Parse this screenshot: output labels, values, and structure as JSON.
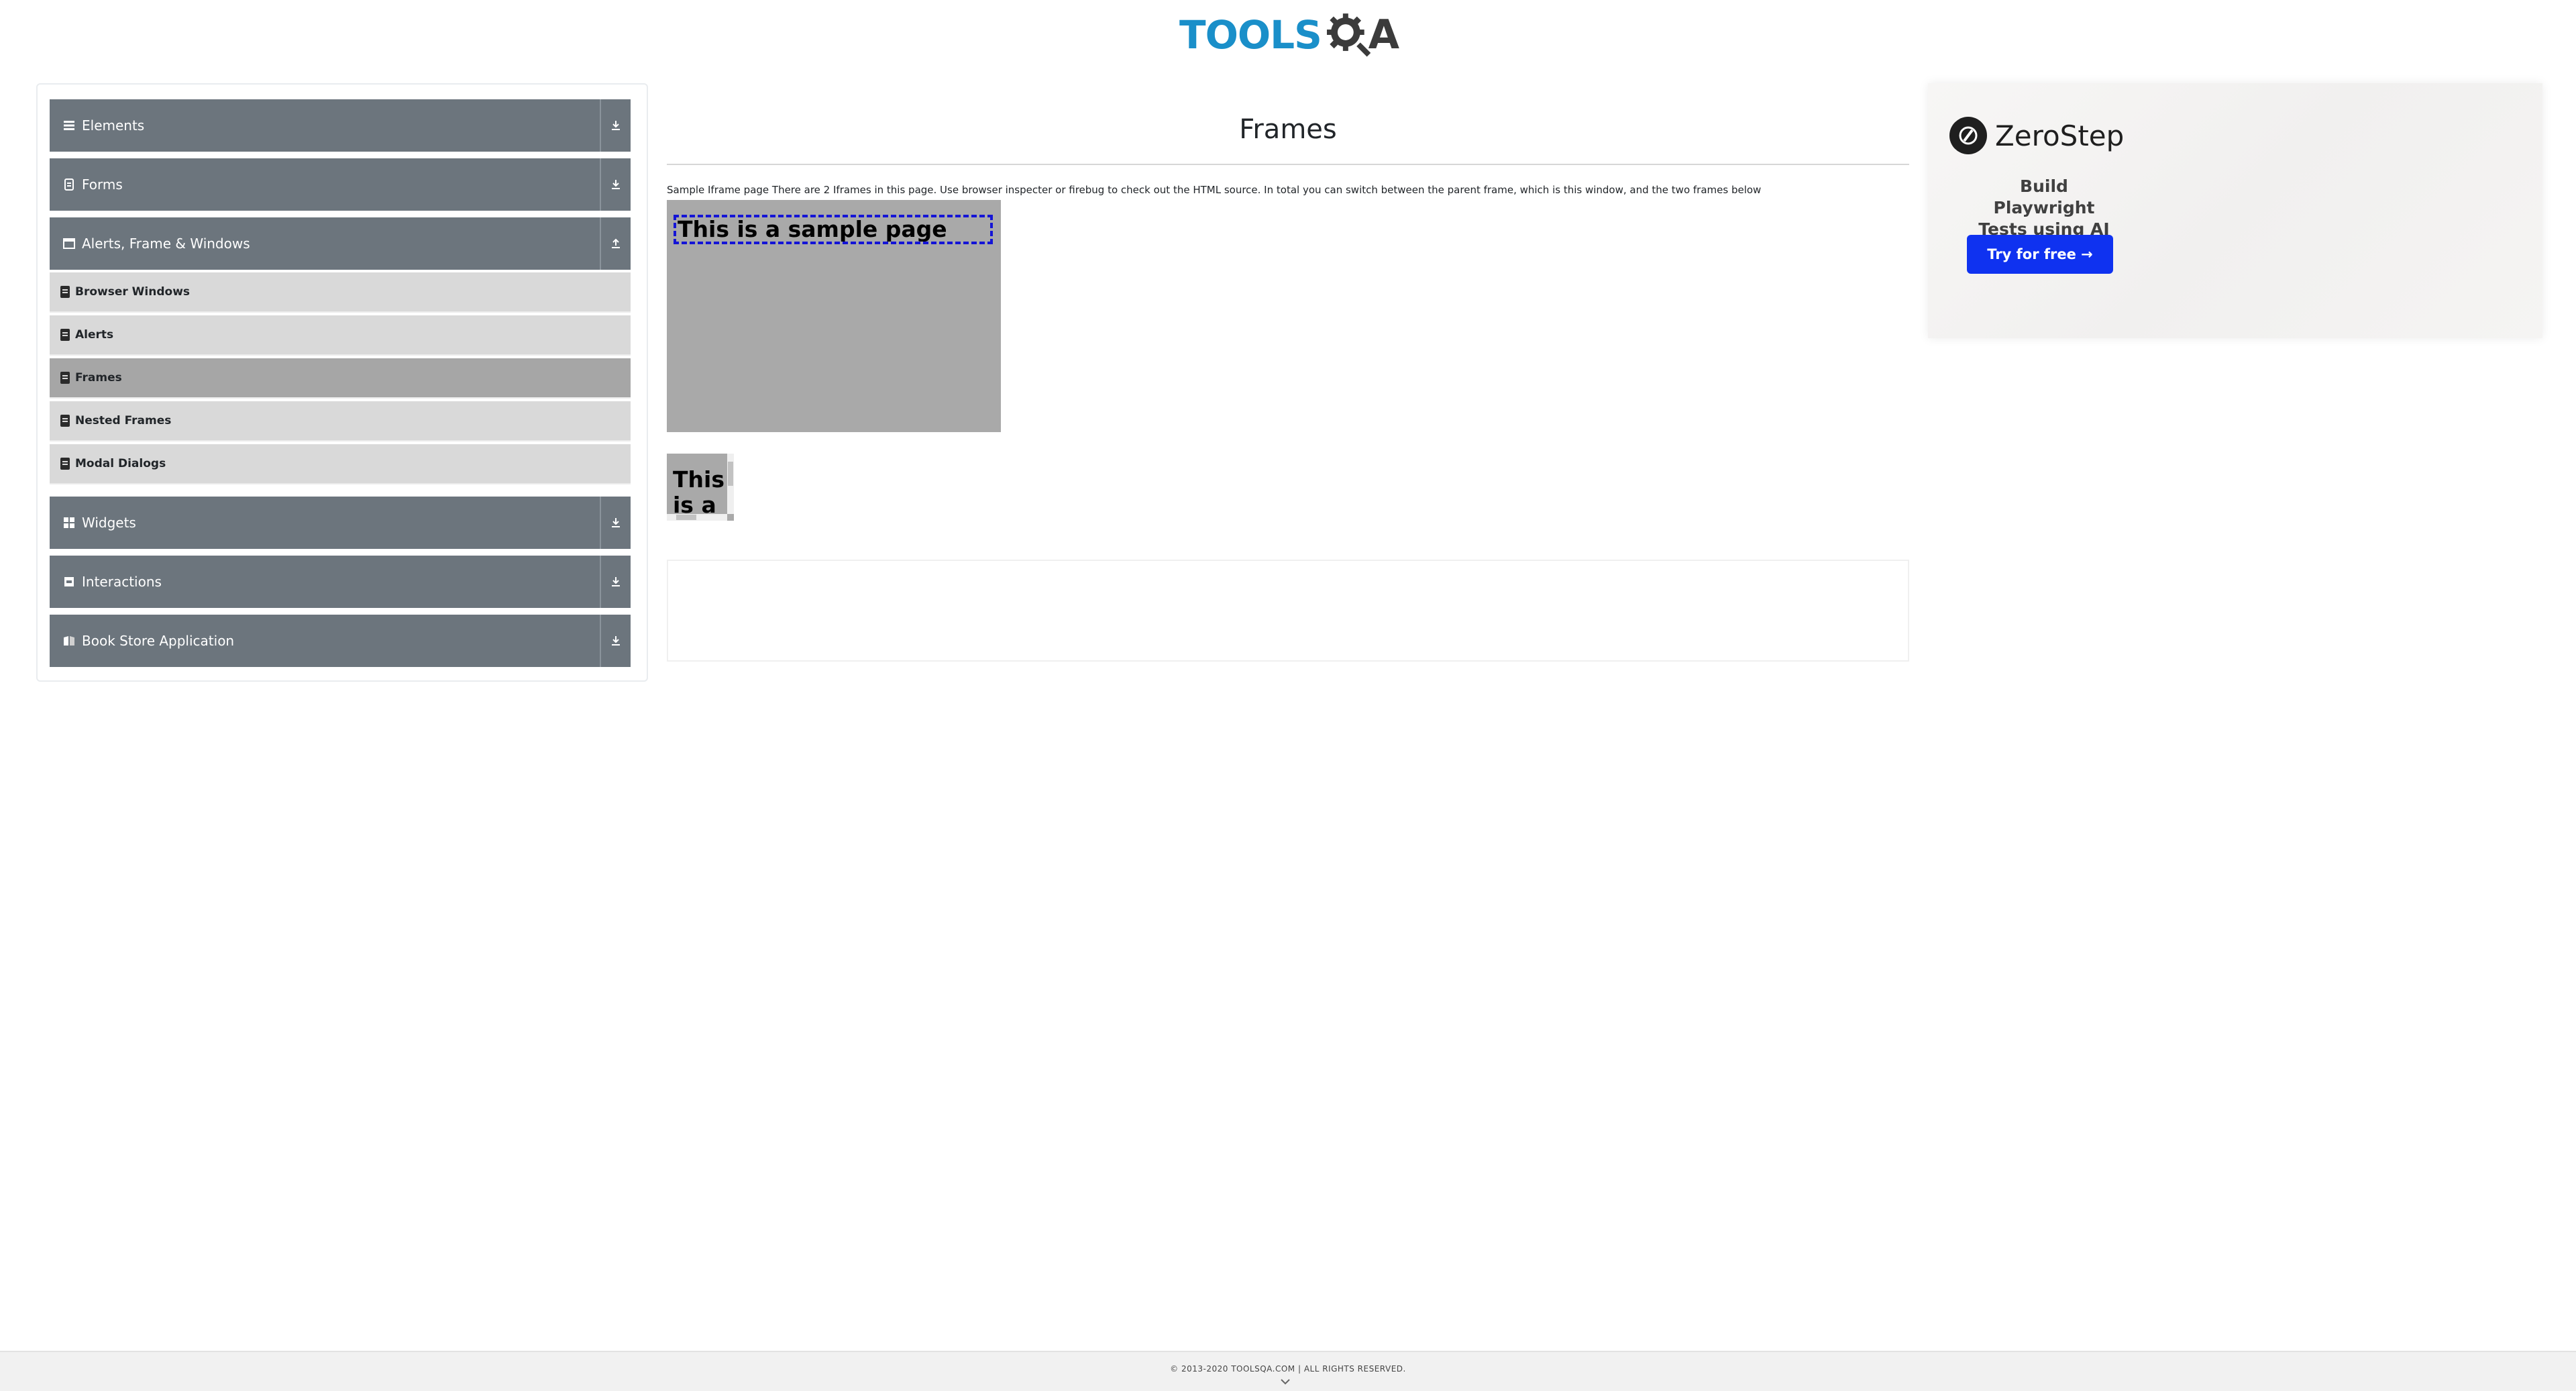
{
  "header": {
    "logo_main": "TOOLS",
    "logo_end": "A"
  },
  "sidebar": {
    "groups": [
      {
        "label": "Elements",
        "icon": "hamburger-icon",
        "toggle": "download-icon"
      },
      {
        "label": "Forms",
        "icon": "document-icon",
        "toggle": "download-icon"
      },
      {
        "label": "Alerts, Frame & Windows",
        "icon": "window-icon",
        "toggle": "upload-icon"
      },
      {
        "label": "Widgets",
        "icon": "grid-icon",
        "toggle": "download-icon"
      },
      {
        "label": "Interactions",
        "icon": "square-icon",
        "toggle": "download-icon"
      },
      {
        "label": "Book Store Application",
        "icon": "book-icon",
        "toggle": "download-icon"
      }
    ],
    "sub_items": [
      {
        "label": "Browser Windows"
      },
      {
        "label": "Alerts"
      },
      {
        "label": "Frames",
        "active": true
      },
      {
        "label": "Nested Frames"
      },
      {
        "label": "Modal Dialogs"
      }
    ]
  },
  "main": {
    "title": "Frames",
    "description": "Sample Iframe page There are 2 Iframes in this page. Use browser inspecter or firebug to check out the HTML source. In total you can switch between the parent frame, which is this window, and the two frames below",
    "frame1_heading": "This is a sample page",
    "frame2_heading": "This is a"
  },
  "ad": {
    "brand": "ZeroStep",
    "tagline": "Build Playwright Tests using AI",
    "button": "Try for free →"
  },
  "footer": {
    "text": "© 2013-2020 TOOLSQA.COM | ALL RIGHTS RESERVED."
  },
  "colors": {
    "group_header": "#6c757d",
    "sub_item": "#d9d9d9",
    "sub_item_active": "#a6a6a6",
    "ad_button": "#0f32f0",
    "logo_blue": "#1a8fc9"
  }
}
